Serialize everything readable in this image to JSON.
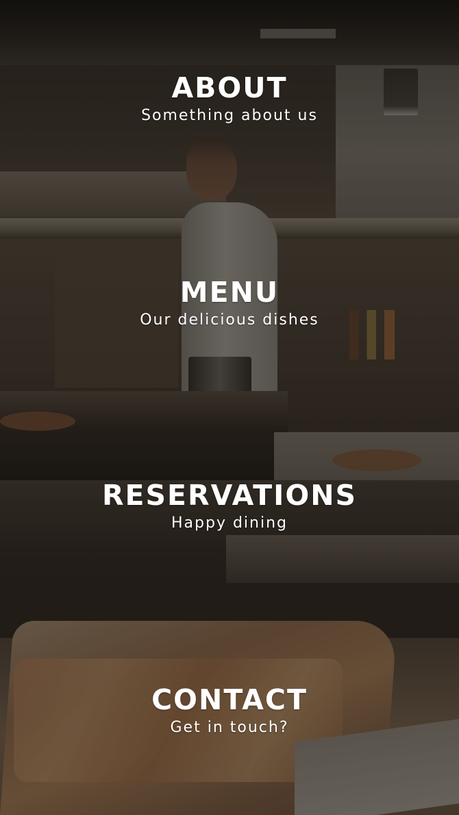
{
  "navigation": {
    "items": [
      {
        "title": "ABOUT",
        "subtitle": "Something about us"
      },
      {
        "title": "MENU",
        "subtitle": "Our delicious dishes"
      },
      {
        "title": "RESERVATIONS",
        "subtitle": "Happy dining"
      },
      {
        "title": "CONTACT",
        "subtitle": "Get in touch?"
      }
    ]
  },
  "colors": {
    "text": "#ffffff",
    "overlay": "#0c0a08"
  }
}
